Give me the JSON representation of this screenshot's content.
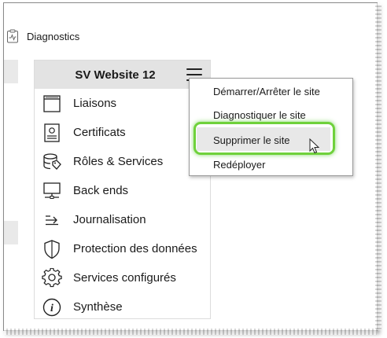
{
  "header": {
    "title": "Diagnostics",
    "icon": "clipboard-chart-icon"
  },
  "panel": {
    "title": "SV Website 12",
    "menu_icon": "hamburger-menu-icon",
    "items": [
      {
        "label": "Liaisons",
        "icon": "window-bindings-icon"
      },
      {
        "label": "Certificats",
        "icon": "certificate-icon"
      },
      {
        "label": "Rôles & Services",
        "icon": "database-tag-icon"
      },
      {
        "label": "Back ends",
        "icon": "monitor-network-icon"
      },
      {
        "label": "Journalisation",
        "icon": "log-arrow-icon"
      },
      {
        "label": "Protection des données",
        "icon": "shield-icon"
      },
      {
        "label": "Services configurés",
        "icon": "gear-icon"
      },
      {
        "label": "Synthèse",
        "icon": "info-icon"
      }
    ]
  },
  "dropdown": {
    "items": [
      {
        "label": "Démarrer/Arrêter le site"
      },
      {
        "label": "Diagnostiquer le site"
      },
      {
        "label": "Supprimer le site",
        "highlighted": true
      },
      {
        "label": "Redéployer"
      }
    ],
    "highlight_color": "#6fd13b"
  }
}
